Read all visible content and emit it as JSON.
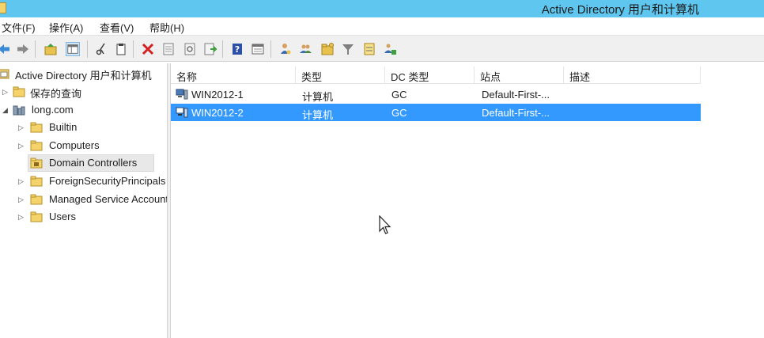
{
  "window": {
    "title": "Active Directory 用户和计算机"
  },
  "menu": [
    {
      "label": "文件(F)"
    },
    {
      "label": "操作(A)"
    },
    {
      "label": "查看(V)"
    },
    {
      "label": "帮助(H)"
    }
  ],
  "toolbar": {
    "icons": [
      "back-arrow-icon",
      "forward-arrow-icon",
      "up-folder-icon",
      "show-pane-icon",
      "cut-icon",
      "copy-icon",
      "delete-icon",
      "properties-icon",
      "refresh-icon",
      "export-icon",
      "help-icon",
      "view-icon",
      "user-icon",
      "group-icon",
      "folder-icon",
      "filter-icon",
      "query-icon",
      "delegate-icon"
    ]
  },
  "tree": {
    "root": "Active Directory 用户和计算机",
    "items": [
      {
        "label": "保存的查询",
        "expander": "collapsed"
      },
      {
        "label": "long.com",
        "expander": "expanded"
      },
      {
        "label": "Builtin",
        "expander": "collapsed"
      },
      {
        "label": "Computers",
        "expander": "collapsed"
      },
      {
        "label": "Domain Controllers",
        "expander": "none",
        "selected": true
      },
      {
        "label": "ForeignSecurityPrincipals",
        "expander": "collapsed"
      },
      {
        "label": "Managed Service Accounts",
        "expander": "collapsed"
      },
      {
        "label": "Users",
        "expander": "collapsed"
      }
    ]
  },
  "list": {
    "columns": [
      "名称",
      "类型",
      "DC 类型",
      "站点",
      "描述"
    ],
    "rows": [
      {
        "name": "WIN2012-1",
        "type": "计算机",
        "dc_type": "GC",
        "site": "Default-First-...",
        "description": "",
        "selected": false
      },
      {
        "name": "WIN2012-2",
        "type": "计算机",
        "dc_type": "GC",
        "site": "Default-First-...",
        "description": "",
        "selected": true
      }
    ]
  },
  "colors": {
    "titlebar": "#5ec6ef",
    "selection": "#3399ff",
    "folder": "#f4d36a"
  }
}
